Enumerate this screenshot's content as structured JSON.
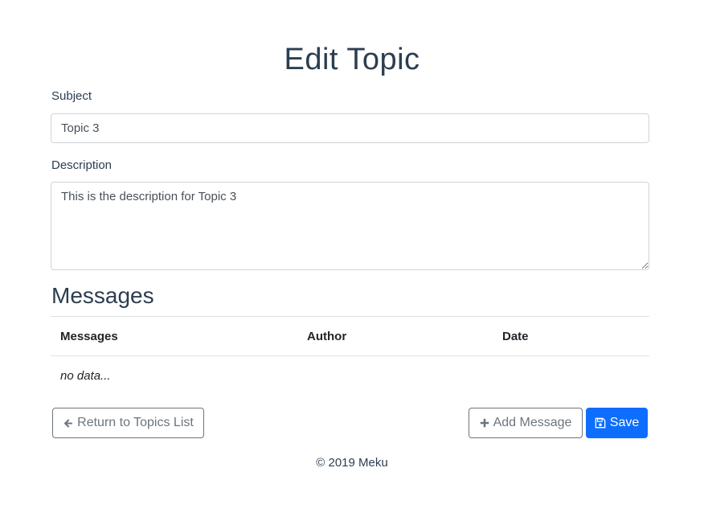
{
  "page": {
    "title": "Edit Topic"
  },
  "form": {
    "subject_label": "Subject",
    "subject_value": "Topic 3",
    "description_label": "Description",
    "description_value": "This is the description for Topic 3"
  },
  "messages": {
    "heading": "Messages",
    "columns": [
      "Messages",
      "Author",
      "Date"
    ],
    "empty_text": "no data..."
  },
  "actions": {
    "return_label": "Return to Topics List",
    "add_label": "Add Message",
    "save_label": "Save"
  },
  "icons": {
    "return": "arrow-left-icon",
    "add": "plus-icon",
    "save": "floppy-disk-icon"
  },
  "colors": {
    "primary": "#0d6efd",
    "heading": "#2c3e50",
    "outline": "#6c757d"
  },
  "footer": {
    "text": "© 2019 Meku"
  }
}
